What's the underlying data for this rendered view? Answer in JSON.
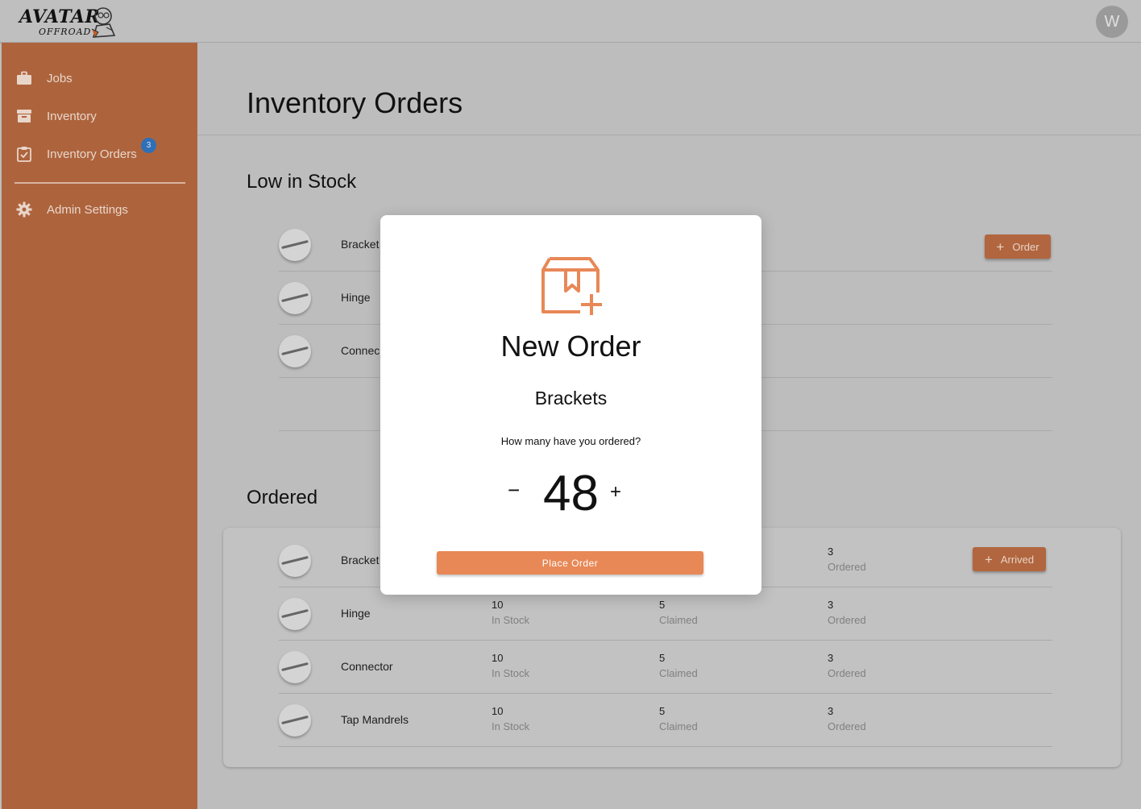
{
  "header": {
    "logo_text": "AVATAR",
    "logo_sub": "OFFROAD",
    "avatar_initial": "W"
  },
  "sidebar": {
    "items": [
      {
        "label": "Jobs",
        "icon": "briefcase-icon"
      },
      {
        "label": "Inventory",
        "icon": "archive-box-icon"
      },
      {
        "label": "Inventory Orders",
        "icon": "clipboard-check-icon",
        "badge": "3"
      },
      {
        "label": "Admin Settings",
        "icon": "gear-icon"
      }
    ]
  },
  "main": {
    "title": "Inventory Orders",
    "low_stock": {
      "title": "Low in Stock",
      "rows": [
        {
          "name": "Bracket",
          "action": "Order"
        },
        {
          "name": "Hinge"
        },
        {
          "name": "Connec"
        }
      ]
    },
    "ordered": {
      "title": "Ordered",
      "stat_labels": {
        "in_stock": "In Stock",
        "claimed": "Claimed",
        "ordered": "Ordered"
      },
      "rows": [
        {
          "name": "Bracket",
          "in_stock": "",
          "claimed": "",
          "ordered": "3",
          "action": "Arrived"
        },
        {
          "name": "Hinge",
          "in_stock": "10",
          "claimed": "5",
          "ordered": "3"
        },
        {
          "name": "Connector",
          "in_stock": "10",
          "claimed": "5",
          "ordered": "3"
        },
        {
          "name": "Tap Mandrels",
          "in_stock": "10",
          "claimed": "5",
          "ordered": "3"
        }
      ]
    }
  },
  "modal": {
    "title": "New Order",
    "item": "Brackets",
    "question": "How many have you ordered?",
    "minus": "−",
    "quantity": "48",
    "plus": "+",
    "submit_label": "Place Order"
  },
  "colors": {
    "sidebar": "#ad643d",
    "accent": "#e88856",
    "button_dimmed": "#b1663f",
    "badge": "#2f6fb7"
  }
}
